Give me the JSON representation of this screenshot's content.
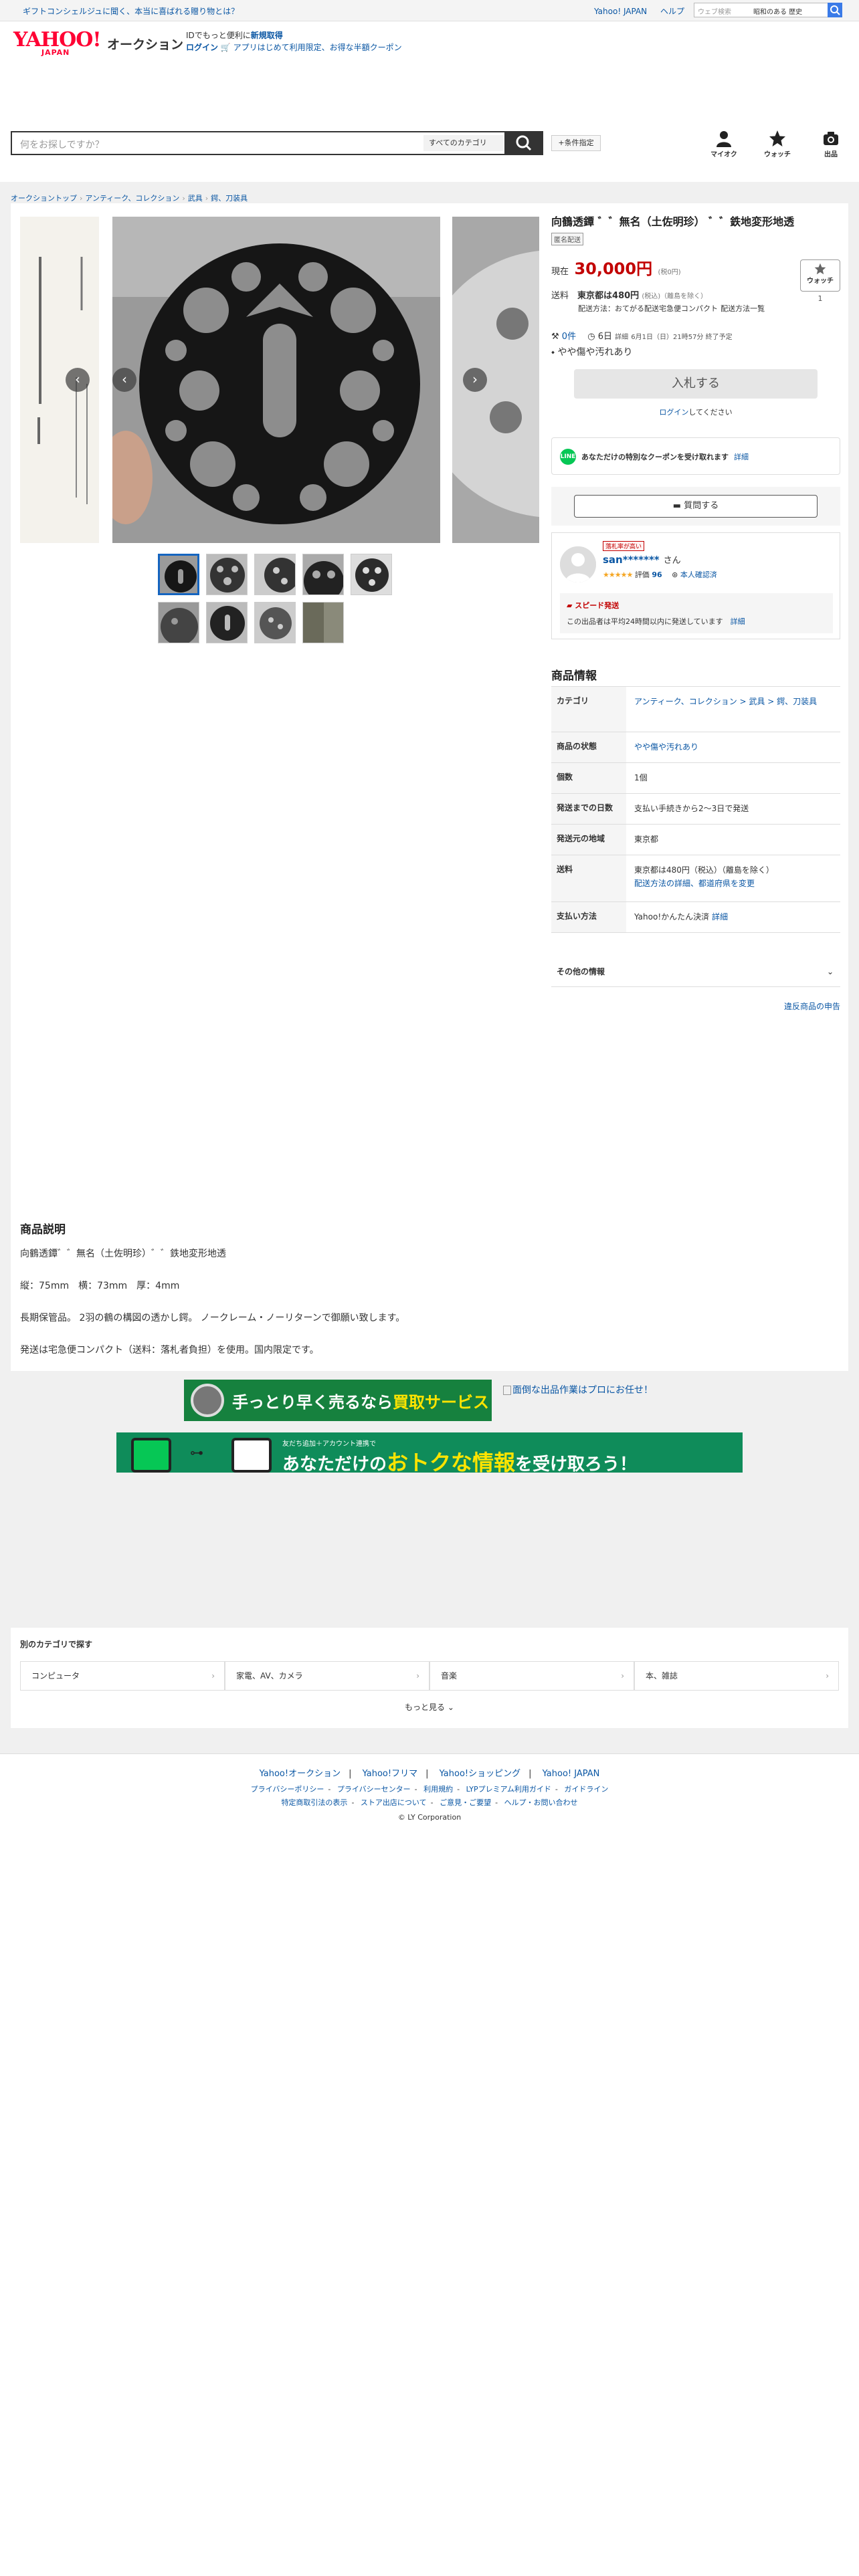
{
  "topbar": {
    "promo": "ギフトコンシェルジュに聞く、本当に喜ばれる贈り物とは？",
    "links": [
      "Yahoo! JAPAN",
      "ヘルプ"
    ],
    "mini_search_placeholder": "ウェブ検索",
    "mini_search_keyword": "昭和のある 歴史"
  },
  "header": {
    "logo_main": "YAHOO!",
    "logo_sub": "JAPAN",
    "logo_service": "オークション",
    "msg_line1_prefix": "IDでもっと便利に",
    "msg_line1_link": "新規取得",
    "msg_line2_login": "ログイン",
    "msg_line2_coupon": "🛒 アプリはじめて利用限定、お得な半額クーポン",
    "search_placeholder": "何をお探しですか？",
    "search_category": "すべてのカテゴリ",
    "condition_button": "+条件指定",
    "icons": [
      {
        "label": "マイオク",
        "icon": "person-icon"
      },
      {
        "label": "ウォッチ",
        "icon": "star-icon"
      },
      {
        "label": "出品",
        "icon": "camera-icon"
      }
    ]
  },
  "breadcrumb": [
    "オークショントップ",
    "アンティーク、コレクション",
    "武具",
    "鍔、刀装具"
  ],
  "item": {
    "title": "向鶴透鐔 ゛゛無名（土佐明珍） ゛゛鉄地変形地透",
    "anon_badge": "匿名配送",
    "price_label": "現在",
    "price": "30,000円",
    "price_tax": "(税0円)",
    "watch_label": "ウォッチ",
    "watch_count": "1",
    "shipping_label": "送料",
    "shipping_text": "東京都は480円",
    "shipping_tax": "(税込)（離島を除く）",
    "shipping_method": "配送方法：おてがる配送宅急便コンパクト",
    "shipping_list_link": "配送方法一覧",
    "bids": "0件",
    "time_left": "6日",
    "time_detail_link": "詳細",
    "end_time": "6月1日（日）21時57分 終了予定",
    "condition": "やや傷や汚れあり",
    "bid_button": "入札する",
    "login_link": "ログイン",
    "login_suffix": "してください",
    "coupon_text": "あなただけの特別なクーポンを受け取れます",
    "coupon_link": "詳細",
    "question_button": "質問する",
    "seller_tag": "落札率が高い",
    "seller_name": "san*******",
    "seller_honorific": "さん",
    "seller_rating_label": "評価",
    "seller_rating": "96",
    "seller_verified": "本人確認済",
    "speed_title": "スピード発送",
    "speed_desc": "この出品者は平均24時間以内に発送しています",
    "speed_link": "詳細"
  },
  "info": {
    "heading": "商品情報",
    "rows": [
      {
        "key": "カテゴリ",
        "value": "アンティーク、コレクション > 武具 > 鍔、刀装具"
      },
      {
        "key": "商品の状態",
        "value": "やや傷や汚れあり"
      },
      {
        "key": "個数",
        "value": "1個"
      },
      {
        "key": "発送までの日数",
        "value": "支払い手続きから2〜3日で発送"
      },
      {
        "key": "発送元の地域",
        "value": "東京都"
      },
      {
        "key": "送料",
        "value": "東京都は480円（税込）（離島を除く）",
        "value2": "配送方法の詳細、都道府県を変更"
      },
      {
        "key": "支払い方法",
        "value": "Yahoo!かんたん決済",
        "value2": "詳細"
      }
    ],
    "other": "その他の情報",
    "report": "違反商品の申告"
  },
  "description": {
    "heading": "商品説明",
    "lines": [
      "向鶴透鐔゛゛無名（土佐明珍）゛゛鉄地変形地透",
      "縦：75mm　横：73mm　厚：4mm",
      "長期保管品。 2羽の鶴の構図の透かし鍔。 ノークレーム・ノーリターンで御願い致します。",
      "発送は宅急便コンパクト（送料：落札者負担）を使用。国内限定です。"
    ]
  },
  "banners": {
    "b1_text": "手っとり早く売るなら",
    "b1_highlight": "買取サービス",
    "b2_alt": "面倒な出品作業はプロにお任せ！",
    "b3_small": "友だち追加＋アカウント連携で",
    "b3_pre": "あなただけの",
    "b3_highlight": "おトクな情報",
    "b3_post": "を受け取ろう！"
  },
  "categories": {
    "heading": "別のカテゴリで探す",
    "items": [
      "コンピュータ",
      "家電、AV、カメラ",
      "音楽",
      "本、雑誌"
    ],
    "more": "もっと見る"
  },
  "footer": {
    "row1": [
      "Yahoo!オークション",
      "Yahoo!フリマ",
      "Yahoo!ショッピング",
      "Yahoo! JAPAN"
    ],
    "row2": [
      "プライバシーポリシー",
      "プライバシーセンター",
      "利用規約",
      "LYPプレミアム利用ガイド",
      "ガイドライン"
    ],
    "row3": [
      "特定商取引法の表示",
      "ストア出店について",
      "ご意見・ご要望",
      "ヘルプ・お問い合わせ"
    ],
    "copyright": "© LY Corporation"
  },
  "colors": {
    "price": "#c20000",
    "link": "#0b57a4",
    "brand": "#ff0033"
  }
}
